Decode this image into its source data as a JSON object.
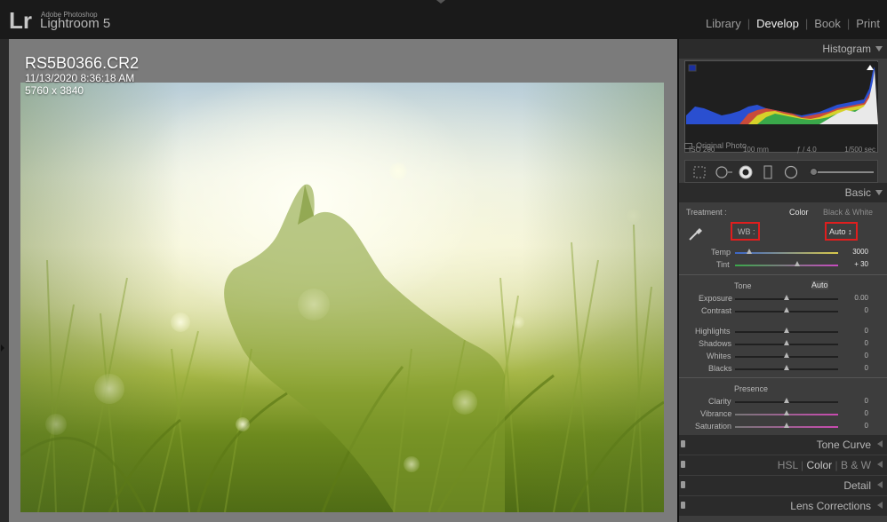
{
  "app": {
    "brand_small": "Adobe Photoshop",
    "brand_name": "Lightroom 5",
    "logo": "Lr"
  },
  "modules": [
    {
      "label": "Library",
      "active": false
    },
    {
      "label": "Develop",
      "active": true
    },
    {
      "label": "Book",
      "active": false
    },
    {
      "label": "Print",
      "active": false
    }
  ],
  "photo_info": {
    "filename": "RS5B0366.CR2",
    "datetime": "11/13/2020 8:36:18 AM",
    "dimensions": "5760 x 3840"
  },
  "histogram": {
    "title": "Histogram",
    "iso": "ISO 200",
    "focal": "100 mm",
    "aperture": "ƒ / 4.0",
    "shutter": "1/500 sec",
    "original_photo": "Original Photo"
  },
  "basic": {
    "title": "Basic",
    "treatment_label": "Treatment :",
    "treatment_color": "Color",
    "treatment_bw": "Black & White",
    "wb_label": "WB :",
    "wb_value": "Auto ↕",
    "temp_label": "Temp",
    "temp_value": "3000",
    "tint_label": "Tint",
    "tint_value": "+ 30",
    "tone_label": "Tone",
    "tone_auto": "Auto",
    "exposure_label": "Exposure",
    "exposure_value": "0.00",
    "contrast_label": "Contrast",
    "contrast_value": "0",
    "highlights_label": "Highlights",
    "highlights_value": "0",
    "shadows_label": "Shadows",
    "shadows_value": "0",
    "whites_label": "Whites",
    "whites_value": "0",
    "blacks_label": "Blacks",
    "blacks_value": "0",
    "presence_label": "Presence",
    "clarity_label": "Clarity",
    "clarity_value": "0",
    "vibrance_label": "Vibrance",
    "vibrance_value": "0",
    "saturation_label": "Saturation",
    "saturation_value": "0"
  },
  "panels": {
    "tone_curve": "Tone Curve",
    "hsl": "HSL",
    "color": "Color",
    "bw": "B & W",
    "detail": "Detail",
    "lens_corrections": "Lens Corrections"
  },
  "colors": {
    "highlight_box": "#e01e1e",
    "active_module": "#f0f0f0"
  }
}
